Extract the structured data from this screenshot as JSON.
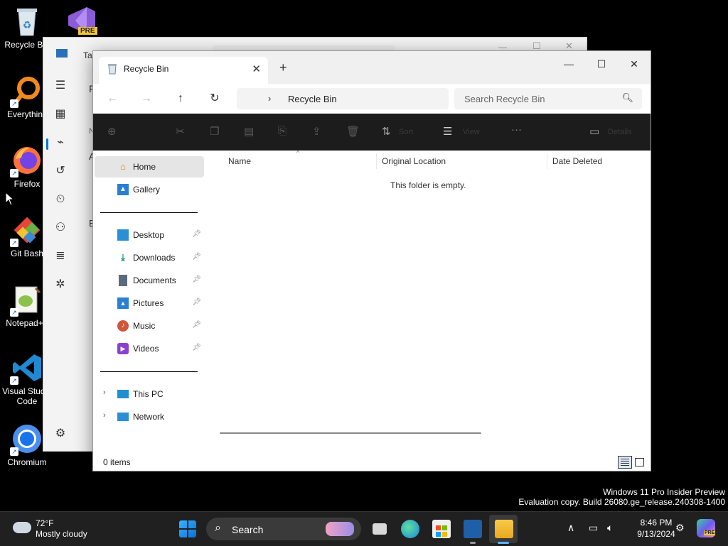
{
  "desktop": {
    "icons": [
      {
        "label": "Recycle Bin"
      },
      {
        "label": "Everything"
      },
      {
        "label": "Firefox"
      },
      {
        "label": "Git Bash"
      },
      {
        "label": "Notepad++"
      },
      {
        "label": "Visual Studio\nCode"
      },
      {
        "label": "Chromium"
      }
    ],
    "vs_badge": "PRE"
  },
  "bg_window": {
    "title": "Ta",
    "peek_letters": [
      "F",
      "N",
      "A",
      "E"
    ]
  },
  "explorer": {
    "tab_title": "Recycle Bin",
    "new_tab": "+",
    "window_controls": {
      "minimize": "—",
      "maximize": "☐",
      "close": "✕"
    },
    "breadcrumb": "Recycle Bin",
    "search_placeholder": "Search Recycle Bin",
    "commands": {
      "sort": "Sort",
      "view": "View",
      "more": "···",
      "details": "Details"
    },
    "nav": {
      "home": "Home",
      "gallery": "Gallery",
      "pinned": [
        {
          "label": "Desktop",
          "icon": "desktop-icon",
          "color": "#2b8fd6"
        },
        {
          "label": "Downloads",
          "icon": "downloads-icon",
          "color": "#1c9e6f"
        },
        {
          "label": "Documents",
          "icon": "documents-icon",
          "color": "#5a6b80"
        },
        {
          "label": "Pictures",
          "icon": "pictures-icon",
          "color": "#2a7fd4"
        },
        {
          "label": "Music",
          "icon": "music-icon",
          "color": "#d0563a"
        },
        {
          "label": "Videos",
          "icon": "videos-icon",
          "color": "#8a3fd1"
        }
      ],
      "this_pc": "This PC",
      "network": "Network"
    },
    "columns": {
      "name": "Name",
      "original_location": "Original Location",
      "date_deleted": "Date Deleted"
    },
    "empty_message": "This folder is empty.",
    "status": "0 items"
  },
  "watermark": {
    "line1": "Windows 11 Pro Insider Preview",
    "line2": "Evaluation copy. Build 26080.ge_release.240308-1400"
  },
  "taskbar": {
    "weather": {
      "temp": "72°F",
      "desc": "Mostly cloudy"
    },
    "search": "Search",
    "clock": {
      "time": "8:46 PM",
      "date": "9/13/2024"
    },
    "copilot_badge": "PRE"
  },
  "colors": {
    "accent": "#0078d4",
    "cmdbar": "#1c1c1c",
    "taskbar": "#202020"
  }
}
